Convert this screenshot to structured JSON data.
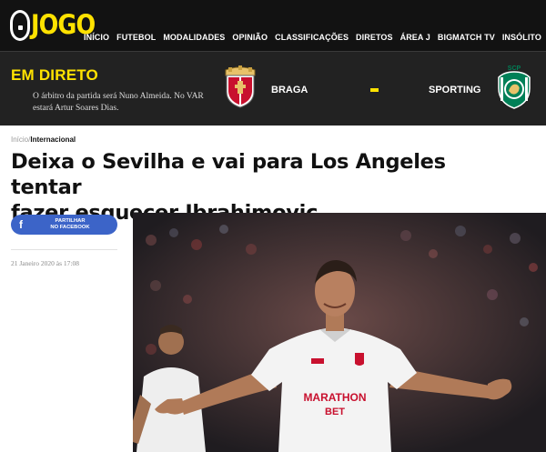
{
  "header": {
    "logo_o": "O",
    "logo_word": "JOGO",
    "nav": [
      "INÍCIO",
      "FUTEBOL",
      "MODALIDADES",
      "OPINIÃO",
      "CLASSIFICAÇÕES",
      "DIRETOS",
      "ÁREA J",
      "BIGMATCH TV",
      "INSÓLITO"
    ]
  },
  "live": {
    "title": "EM DIRETO",
    "text": "O árbitro da partida será Nuno Almeida. No VAR estará Artur Soares Dias.",
    "home_team": "BRAGA",
    "away_team": "SPORTING"
  },
  "breadcrumb": {
    "home": "Início",
    "separator": "/",
    "current": "Internacional"
  },
  "article": {
    "headline_line1": "Deixa o Sevilha e vai para Los Angeles tentar",
    "headline_line2": "fazer esquecer Ibrahimovic",
    "share_icon_text": "f",
    "share_line1": "PARTILHAR",
    "share_line2": "NO FACEBOOK",
    "date": "21 Janeiro 2020 às 17:08",
    "photo_sponsor_line1": "MARATHON",
    "photo_sponsor_line2": "BET"
  },
  "colors": {
    "brand_yellow": "#ffe200",
    "nav_bg": "#121212",
    "live_bg": "#222222",
    "facebook_blue": "#3c64c8",
    "braga_red": "#c8102e",
    "sporting_green": "#008057"
  }
}
